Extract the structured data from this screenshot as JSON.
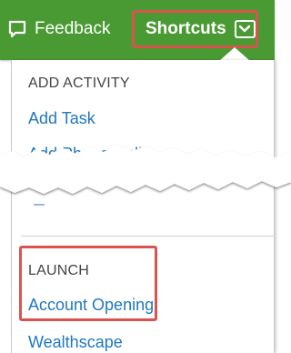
{
  "header": {
    "feedback_label": "Feedback",
    "shortcuts_label": "Shortcuts"
  },
  "menu": {
    "add_activity_heading": "ADD ACTIVITY",
    "add_task_label": "Add Task",
    "partial_item_label": "Add Phone Call",
    "launch_heading": "LAUNCH",
    "account_opening_label": "Account Opening",
    "wealthscape_label": "Wealthscape"
  },
  "colors": {
    "header_bg": "#4a9a34",
    "link": "#1f78c1",
    "highlight": "#d9534f"
  },
  "icons": {
    "feedback": "speech-bubble-icon",
    "shortcuts": "chevron-down-icon"
  }
}
